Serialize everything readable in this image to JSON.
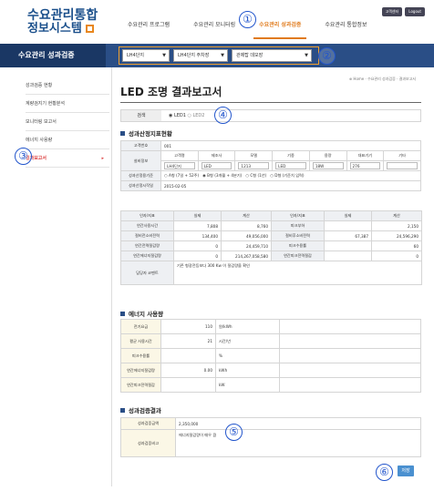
{
  "header": {
    "logo_line1": "수요관리통합",
    "logo_line2": "정보시스템",
    "top_btn1": "고객센터",
    "top_btn2": "Logout",
    "gnb": [
      "수요관리 프로그램",
      "수요관리 모니터링",
      "수요관리 성과검증",
      "수요관리 통합정보"
    ]
  },
  "bar": {
    "title": "수요관리 성과검증",
    "select1": "LH4단지",
    "select2": "LH4단지 주차장",
    "select3": "관제탑 데모장"
  },
  "sidebar": {
    "items": [
      "성과검증 현황",
      "계량검지기 현황분석",
      "모니터링 보고서",
      "에너지 사용량",
      "결과보고서"
    ]
  },
  "markers": [
    "①",
    "②",
    "③",
    "④",
    "⑤",
    "⑥"
  ],
  "breadcrumb": "⊕ Home · 수요관리 성과검증 · 결과보고서",
  "page_title": "LED 조명 결과보고서",
  "radio": {
    "label": "검색",
    "opt1": "LED1",
    "opt2": "LED2"
  },
  "section1": {
    "title": "성과산정지표현황",
    "customer_label": "고객번호",
    "customer_no": "001",
    "equip_label": "설비정보",
    "equip_headers": [
      "고객명",
      "제조사",
      "모델",
      "기종",
      "용량",
      "대표기기",
      "기타"
    ],
    "equip_values": [
      "LH4단지",
      "LED",
      "1213",
      "LED",
      "18W",
      "276",
      ""
    ],
    "period_label": "성과산정용기준",
    "period_opts": [
      "○ A형 (7일 + 52주)",
      "◉ B형 (3개월 + 4분기)",
      "○ C형 (1년)",
      "○ D형 (기준치 입력)"
    ],
    "date_label": "성과산정시작일",
    "date_value": "2015-02-05",
    "metric_headers": [
      "인자/지표",
      "실제",
      "계산",
      "인자/지표",
      "실제",
      "계산"
    ],
    "metric_rows": [
      [
        "연간사용시간",
        "7,808",
        "8,760",
        "피크부하",
        "",
        "2,150"
      ],
      [
        "절비전소비전력",
        "134,400",
        "49,056,000",
        "절비후소비전력",
        "67,387",
        "24,596,290"
      ],
      [
        "연간전력절감량",
        "0",
        "24,459,710",
        "피크수용률",
        "",
        "60"
      ],
      [
        "연간에너지절감량",
        "0",
        "214,267,058,580",
        "연간피크전력절감",
        "",
        "0"
      ]
    ],
    "comment_label": "담당자 코멘트",
    "comment": "기존 형광전등보다 300 Kw 이 절감량을 확인"
  },
  "section2": {
    "title": "에너지 사용량",
    "rows": [
      [
        "전기요금",
        "110",
        "원/kWh"
      ],
      [
        "평균 사용시간",
        "21",
        "시간/년"
      ],
      [
        "피크수용률",
        "",
        "%"
      ],
      [
        "연간에너지절감량",
        "0.00",
        "kWh"
      ],
      [
        "연간피크전력절감",
        "",
        "kW"
      ]
    ]
  },
  "section3": {
    "title": "성과검증결과",
    "amount_label": "성과검증금액",
    "amount": "2,350,000",
    "note_label": "성과검증비고",
    "note": "에너지절감량이 매우 큼"
  },
  "save_label": "저장",
  "colors": {
    "brand": "#1a4f8b",
    "accent": "#e07a1b",
    "bar": "#2a4e86",
    "marker": "#2255cc"
  }
}
